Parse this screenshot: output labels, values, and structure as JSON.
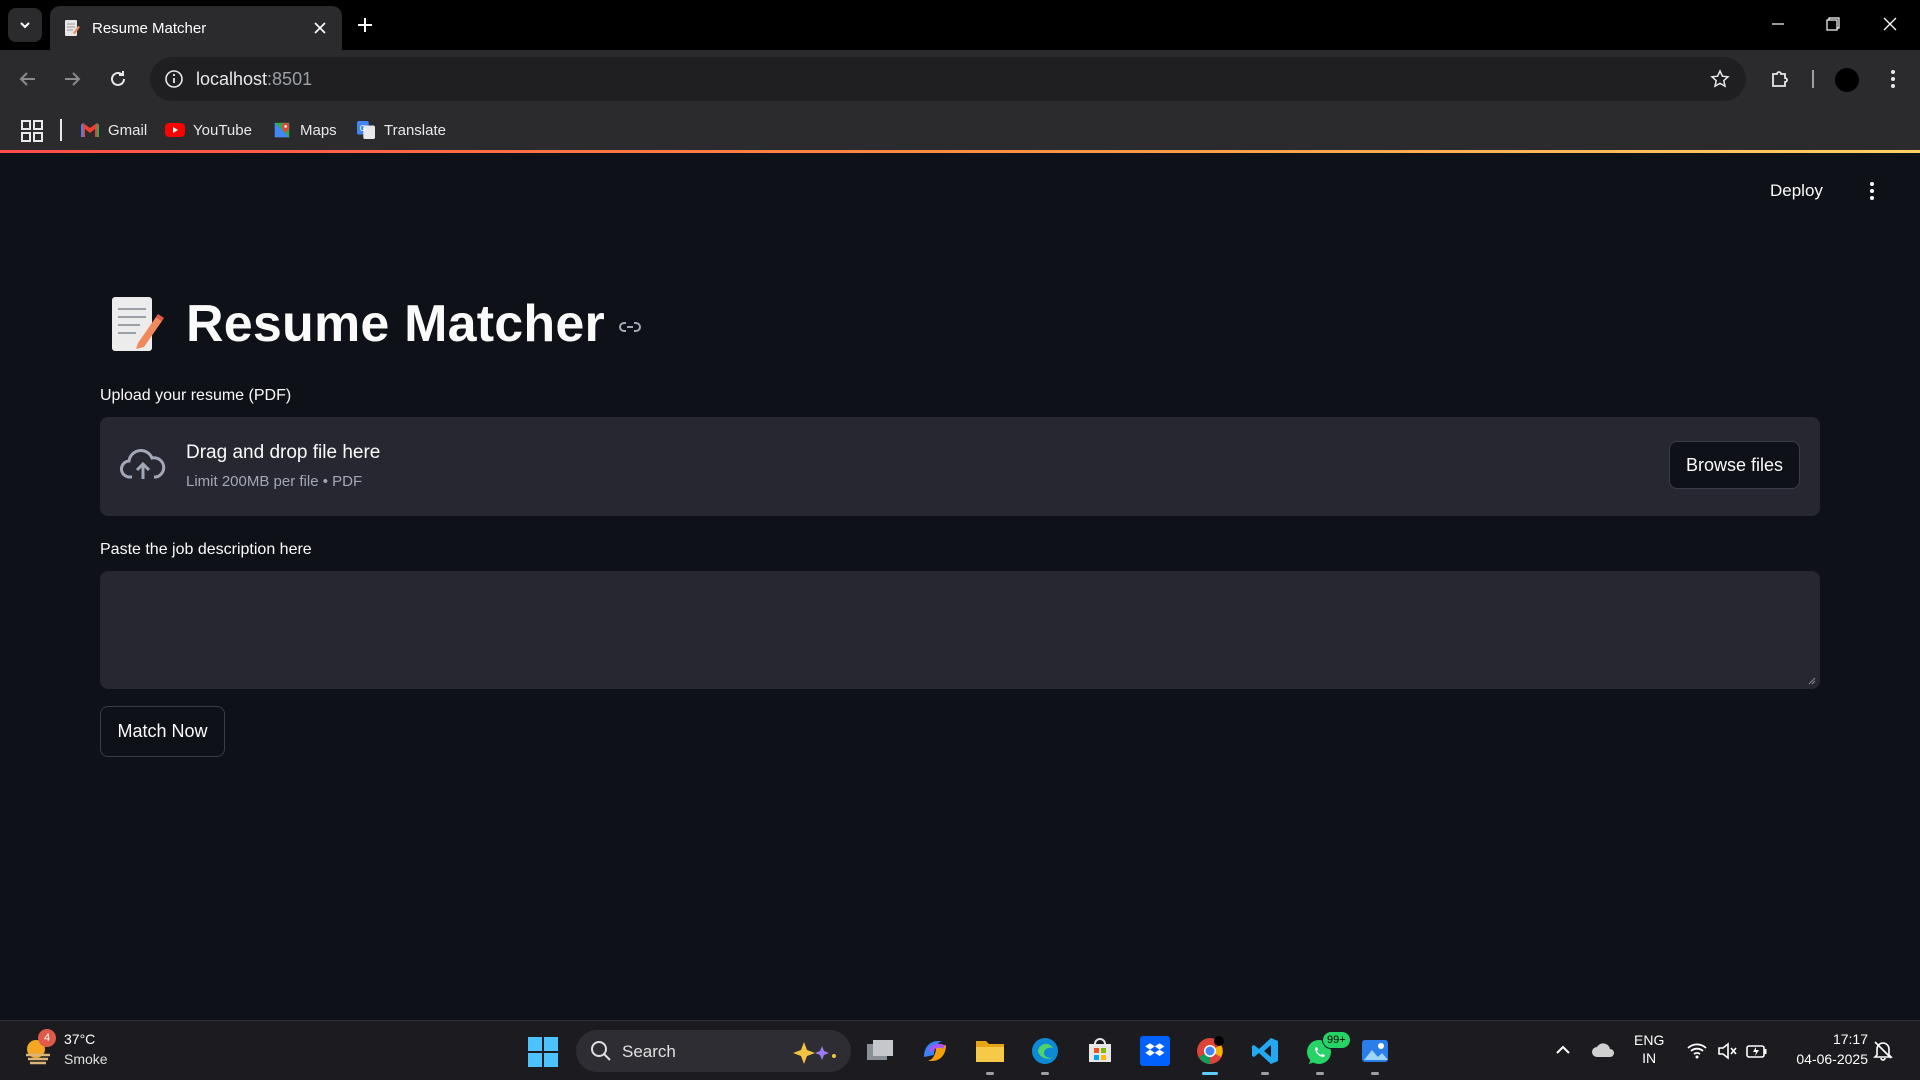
{
  "browser": {
    "tab_title": "Resume Matcher",
    "url_host": "localhost",
    "url_port": ":8501",
    "bookmarks": [
      {
        "label": "Gmail",
        "icon": "gmail-icon"
      },
      {
        "label": "YouTube",
        "icon": "youtube-icon"
      },
      {
        "label": "Maps",
        "icon": "maps-icon"
      },
      {
        "label": "Translate",
        "icon": "translate-icon"
      }
    ]
  },
  "app": {
    "deploy_label": "Deploy",
    "title": "Resume Matcher",
    "title_emoji": "memo-icon",
    "upload_label": "Upload your resume (PDF)",
    "dropzone_text": "Drag and drop file here",
    "dropzone_limit": "Limit 200MB per file • PDF",
    "browse_label": "Browse files",
    "jd_label": "Paste the job description here",
    "jd_value": "",
    "match_label": "Match Now"
  },
  "taskbar": {
    "weather_temp": "37°C",
    "weather_cond": "Smoke",
    "weather_badge": "4",
    "search_placeholder": "Search",
    "whatsapp_badge": "99+",
    "lang_line1": "ENG",
    "lang_line2": "IN",
    "time": "17:17",
    "date": "04-06-2025"
  },
  "colors": {
    "app_bg": "#0e1117",
    "widget_bg": "#262730",
    "accent_gradient_start": "#ff4b4b",
    "accent_gradient_end": "#ffd166"
  }
}
